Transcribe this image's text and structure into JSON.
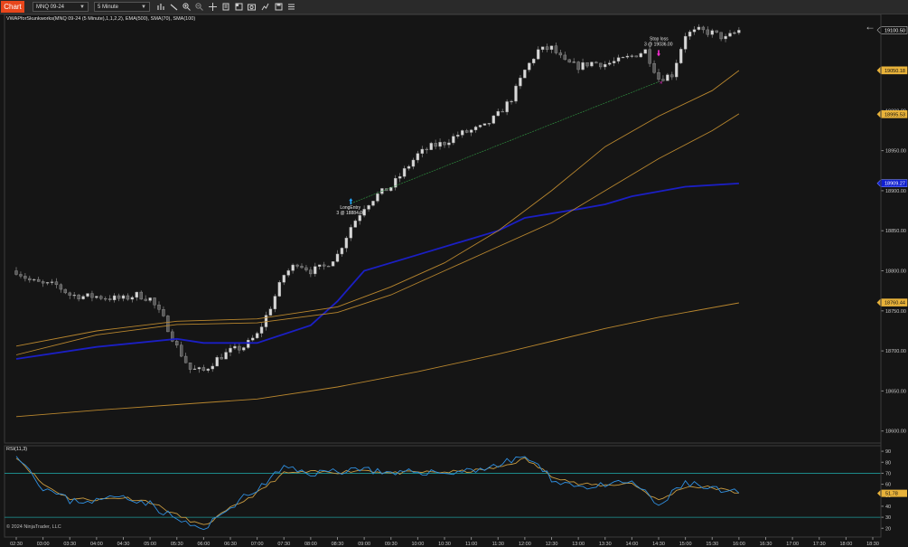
{
  "toolbar": {
    "chart_tab": "Chart",
    "instrument": "MNQ 09-24",
    "interval": "5 Minute"
  },
  "indicator_label": "VWAPforSkunkworks(MNQ 09-24 (5 Minute),1,1,2,2), EMA(500), SMA(70), SMA(100)",
  "rsi_label": "RSI(11,3)",
  "copyright": "© 2024 NinjaTrader, LLC",
  "markers": {
    "long_entry": {
      "name": "LongEntry",
      "fill": "3 @ 18884.00"
    },
    "stop_loss": {
      "name": "Stop loss",
      "fill": "3 @ 19036.00"
    }
  },
  "colors": {
    "background": "#151515",
    "candle": "#9a9a9a",
    "vwap": "#1b1fc4",
    "ma": "#b8862e",
    "rsi_main": "#2f8fe0",
    "rsi_signal": "#c89a40",
    "rsi_band": "#1e9a9a",
    "gold_label": "#e8b23a",
    "blue_label": "#1020d0",
    "entry_arrow": "#25a7ff",
    "stop_arrow": "#ff2bd6"
  },
  "chart_data": [
    {
      "type": "candlestick",
      "title": "",
      "xlabel": "",
      "ylabel": "",
      "x_ticks": [
        "02:30",
        "03:00",
        "03:30",
        "04:00",
        "04:30",
        "05:00",
        "05:30",
        "06:00",
        "06:30",
        "07:00",
        "07:30",
        "08:00",
        "08:30",
        "09:00",
        "09:30",
        "10:00",
        "10:30",
        "11:00",
        "11:30",
        "12:00",
        "12:30",
        "13:00",
        "13:30",
        "14:00",
        "14:30",
        "15:00",
        "15:30",
        "16:00",
        "16:30",
        "17:00",
        "17:30",
        "18:00",
        "18:30"
      ],
      "y_ticks": [
        "19000.00",
        "18950.00",
        "18900.00",
        "18850.00",
        "18800.00",
        "18750.00",
        "18700.00",
        "18650.00",
        "18600.00"
      ],
      "ylim": [
        18585,
        19120
      ],
      "grid": false,
      "price_labels": [
        {
          "value": 19100.5,
          "text": "19100.50",
          "style": "current"
        },
        {
          "value": 19050.18,
          "text": "19050.18",
          "style": "gold"
        },
        {
          "value": 18995.53,
          "text": "18995.53",
          "style": "gold"
        },
        {
          "value": 18909.27,
          "text": "18909.27",
          "style": "blue"
        },
        {
          "value": 18760.44,
          "text": "18760.44",
          "style": "gold"
        }
      ],
      "close_path": [
        [
          "02:30",
          18800
        ],
        [
          "02:45",
          18788
        ],
        [
          "03:00",
          18783
        ],
        [
          "03:15",
          18782
        ],
        [
          "03:30",
          18770
        ],
        [
          "03:45",
          18768
        ],
        [
          "04:00",
          18768
        ],
        [
          "04:15",
          18766
        ],
        [
          "04:30",
          18765
        ],
        [
          "04:45",
          18770
        ],
        [
          "05:00",
          18765
        ],
        [
          "05:15",
          18740
        ],
        [
          "05:30",
          18705
        ],
        [
          "05:45",
          18677
        ],
        [
          "06:00",
          18675
        ],
        [
          "06:15",
          18690
        ],
        [
          "06:30",
          18700
        ],
        [
          "06:45",
          18705
        ],
        [
          "07:00",
          18720
        ],
        [
          "07:15",
          18755
        ],
        [
          "07:30",
          18795
        ],
        [
          "07:45",
          18810
        ],
        [
          "08:00",
          18800
        ],
        [
          "08:15",
          18805
        ],
        [
          "08:30",
          18820
        ],
        [
          "08:45",
          18855
        ],
        [
          "09:00",
          18880
        ],
        [
          "09:15",
          18895
        ],
        [
          "09:30",
          18905
        ],
        [
          "09:45",
          18925
        ],
        [
          "10:00",
          18945
        ],
        [
          "10:15",
          18955
        ],
        [
          "10:30",
          18960
        ],
        [
          "10:45",
          18970
        ],
        [
          "11:00",
          18975
        ],
        [
          "11:15",
          18980
        ],
        [
          "11:30",
          18995
        ],
        [
          "11:45",
          19015
        ],
        [
          "12:00",
          19050
        ],
        [
          "12:15",
          19075
        ],
        [
          "12:30",
          19078
        ],
        [
          "12:45",
          19060
        ],
        [
          "13:00",
          19055
        ],
        [
          "13:15",
          19060
        ],
        [
          "13:30",
          19058
        ],
        [
          "13:45",
          19062
        ],
        [
          "14:00",
          19068
        ],
        [
          "14:15",
          19075
        ],
        [
          "14:30",
          19040
        ],
        [
          "14:45",
          19045
        ],
        [
          "15:00",
          19095
        ],
        [
          "15:15",
          19100
        ],
        [
          "15:30",
          19097
        ],
        [
          "15:45",
          19090
        ],
        [
          "16:00",
          19100
        ]
      ],
      "series": [
        {
          "name": "VWAP",
          "points": [
            [
              "02:30",
              18690
            ],
            [
              "04:00",
              18705
            ],
            [
              "05:30",
              18715
            ],
            [
              "06:00",
              18710
            ],
            [
              "07:00",
              18710
            ],
            [
              "08:00",
              18732
            ],
            [
              "08:30",
              18762
            ],
            [
              "09:00",
              18800
            ],
            [
              "10:00",
              18820
            ],
            [
              "11:00",
              18840
            ],
            [
              "11:30",
              18850
            ],
            [
              "12:00",
              18866
            ],
            [
              "13:00",
              18877
            ],
            [
              "13:30",
              18883
            ],
            [
              "14:00",
              18893
            ],
            [
              "15:00",
              18905
            ],
            [
              "16:00",
              18909
            ]
          ]
        },
        {
          "name": "SMA 70",
          "points": [
            [
              "02:30",
              18706
            ],
            [
              "04:00",
              18725
            ],
            [
              "05:30",
              18737
            ],
            [
              "07:00",
              18740
            ],
            [
              "08:30",
              18755
            ],
            [
              "09:30",
              18780
            ],
            [
              "10:30",
              18810
            ],
            [
              "11:30",
              18850
            ],
            [
              "12:30",
              18900
            ],
            [
              "13:30",
              18955
            ],
            [
              "14:30",
              18993
            ],
            [
              "15:30",
              19025
            ],
            [
              "16:00",
              19050
            ]
          ]
        },
        {
          "name": "SMA 100",
          "points": [
            [
              "02:30",
              18695
            ],
            [
              "04:00",
              18720
            ],
            [
              "05:30",
              18733
            ],
            [
              "07:00",
              18735
            ],
            [
              "08:30",
              18748
            ],
            [
              "09:30",
              18770
            ],
            [
              "10:30",
              18800
            ],
            [
              "11:30",
              18830
            ],
            [
              "12:30",
              18860
            ],
            [
              "13:30",
              18900
            ],
            [
              "14:30",
              18940
            ],
            [
              "15:30",
              18975
            ],
            [
              "16:00",
              18996
            ]
          ]
        },
        {
          "name": "EMA 500",
          "points": [
            [
              "02:30",
              18618
            ],
            [
              "04:00",
              18626
            ],
            [
              "05:30",
              18633
            ],
            [
              "07:00",
              18640
            ],
            [
              "08:30",
              18655
            ],
            [
              "10:00",
              18674
            ],
            [
              "11:30",
              18696
            ],
            [
              "12:30",
              18712
            ],
            [
              "13:30",
              18728
            ],
            [
              "14:30",
              18742
            ],
            [
              "16:00",
              18760
            ]
          ]
        }
      ]
    },
    {
      "type": "line",
      "title": "RSI(11,3)",
      "y_ticks": [
        "90",
        "80",
        "70",
        "60",
        "50",
        "40",
        "30",
        "20"
      ],
      "ylim": [
        12,
        95
      ],
      "bands": [
        70,
        30
      ],
      "rsi_labels": [
        {
          "value": 51.78,
          "text": "51.78",
          "style": "gold"
        }
      ],
      "series": [
        {
          "name": "RSI",
          "points": [
            [
              "02:30",
              89
            ],
            [
              "03:00",
              57
            ],
            [
              "03:30",
              45
            ],
            [
              "04:00",
              45
            ],
            [
              "04:30",
              50
            ],
            [
              "05:00",
              42
            ],
            [
              "05:30",
              28
            ],
            [
              "06:00",
              18
            ],
            [
              "06:30",
              40
            ],
            [
              "07:00",
              55
            ],
            [
              "07:30",
              75
            ],
            [
              "08:00",
              70
            ],
            [
              "08:30",
              72
            ],
            [
              "09:00",
              75
            ],
            [
              "09:30",
              68
            ],
            [
              "10:00",
              72
            ],
            [
              "10:30",
              70
            ],
            [
              "11:00",
              73
            ],
            [
              "11:30",
              77
            ],
            [
              "12:00",
              86
            ],
            [
              "12:30",
              65
            ],
            [
              "13:00",
              58
            ],
            [
              "13:30",
              58
            ],
            [
              "14:00",
              63
            ],
            [
              "14:30",
              40
            ],
            [
              "15:00",
              62
            ],
            [
              "15:30",
              55
            ],
            [
              "16:00",
              52
            ]
          ]
        },
        {
          "name": "Signal",
          "points": [
            [
              "02:30",
              85
            ],
            [
              "03:00",
              60
            ],
            [
              "03:30",
              47
            ],
            [
              "04:00",
              46
            ],
            [
              "04:30",
              48
            ],
            [
              "05:00",
              44
            ],
            [
              "05:30",
              32
            ],
            [
              "06:00",
              22
            ],
            [
              "06:30",
              38
            ],
            [
              "07:00",
              52
            ],
            [
              "07:30",
              70
            ],
            [
              "08:00",
              71
            ],
            [
              "08:30",
              71
            ],
            [
              "09:00",
              73
            ],
            [
              "09:30",
              70
            ],
            [
              "10:00",
              71
            ],
            [
              "10:30",
              71
            ],
            [
              "11:00",
              72
            ],
            [
              "11:30",
              75
            ],
            [
              "12:00",
              83
            ],
            [
              "12:30",
              68
            ],
            [
              "13:00",
              60
            ],
            [
              "13:30",
              59
            ],
            [
              "14:00",
              61
            ],
            [
              "14:30",
              45
            ],
            [
              "15:00",
              58
            ],
            [
              "15:30",
              57
            ],
            [
              "16:00",
              52
            ]
          ]
        }
      ]
    }
  ]
}
